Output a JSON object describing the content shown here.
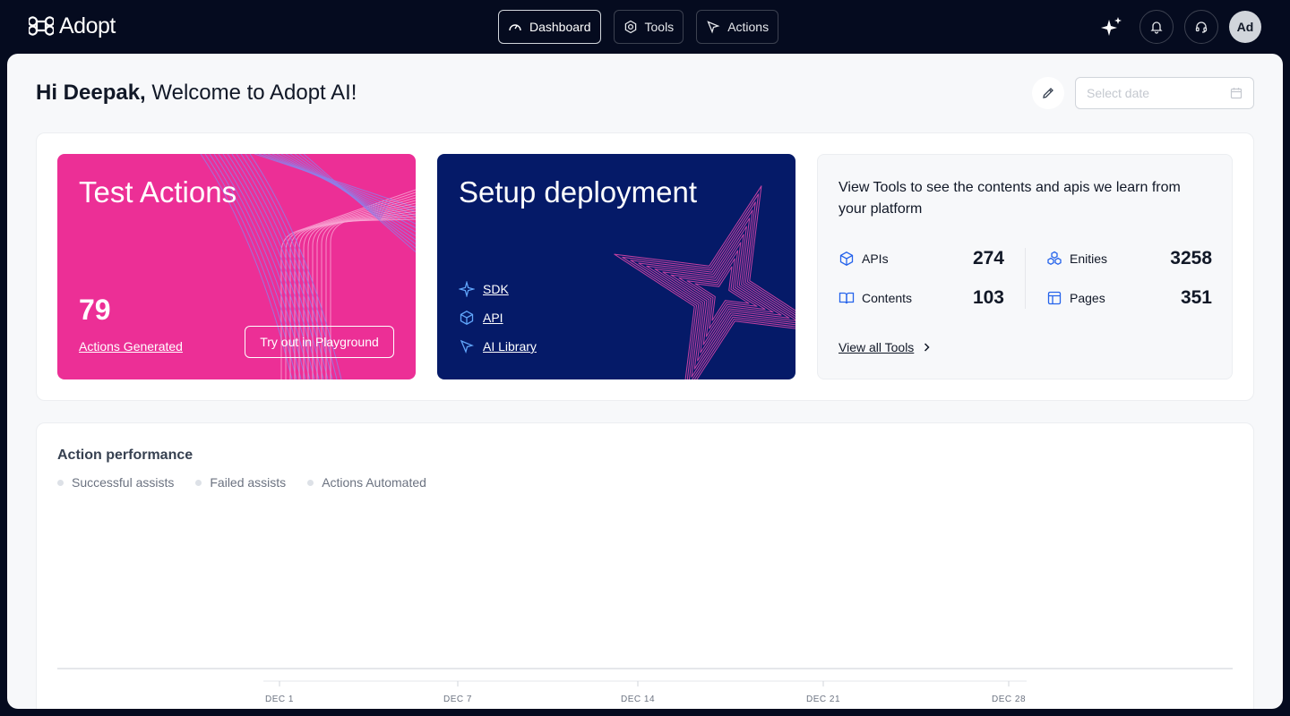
{
  "app": {
    "brand": "Adopt"
  },
  "nav": {
    "items": [
      {
        "label": "Dashboard",
        "icon": "gauge-icon",
        "active": true
      },
      {
        "label": "Tools",
        "icon": "hexagon-icon",
        "active": false
      },
      {
        "label": "Actions",
        "icon": "cursor-icon",
        "active": false
      }
    ]
  },
  "header": {
    "avatar_initials": "Ad",
    "icons": [
      "sparkle-icon",
      "bell-icon",
      "headset-icon"
    ]
  },
  "greeting": {
    "name": "Hi Deepak,",
    "message": " Welcome to Adopt AI!"
  },
  "date_picker": {
    "placeholder": "Select date"
  },
  "test_actions": {
    "title": "Test Actions",
    "count": "79",
    "count_label": "Actions Generated",
    "button": "Try out in Playground",
    "color": "#ec2f96"
  },
  "setup_deployment": {
    "title": "Setup deployment",
    "links": [
      {
        "label": "SDK",
        "icon": "sparkle-outline-icon"
      },
      {
        "label": "API",
        "icon": "cube-icon"
      },
      {
        "label": "AI Library",
        "icon": "cursor-icon"
      }
    ],
    "color": "#051a68"
  },
  "tools_summary": {
    "description": "View Tools to see the contents and apis we learn from your platform",
    "stats": [
      {
        "label": "APIs",
        "value": "274",
        "icon": "cube-icon"
      },
      {
        "label": "Contents",
        "value": "103",
        "icon": "book-icon"
      },
      {
        "label": "Enities",
        "value": "3258",
        "icon": "entities-icon"
      },
      {
        "label": "Pages",
        "value": "351",
        "icon": "layout-icon"
      }
    ],
    "view_all": "View all Tools"
  },
  "performance": {
    "title": "Action performance",
    "legend": [
      "Successful assists",
      "Failed assists",
      "Actions Automated"
    ],
    "x_ticks": [
      "DEC 1",
      "DEC 7",
      "DEC 14",
      "DEC 21",
      "DEC 28"
    ]
  }
}
